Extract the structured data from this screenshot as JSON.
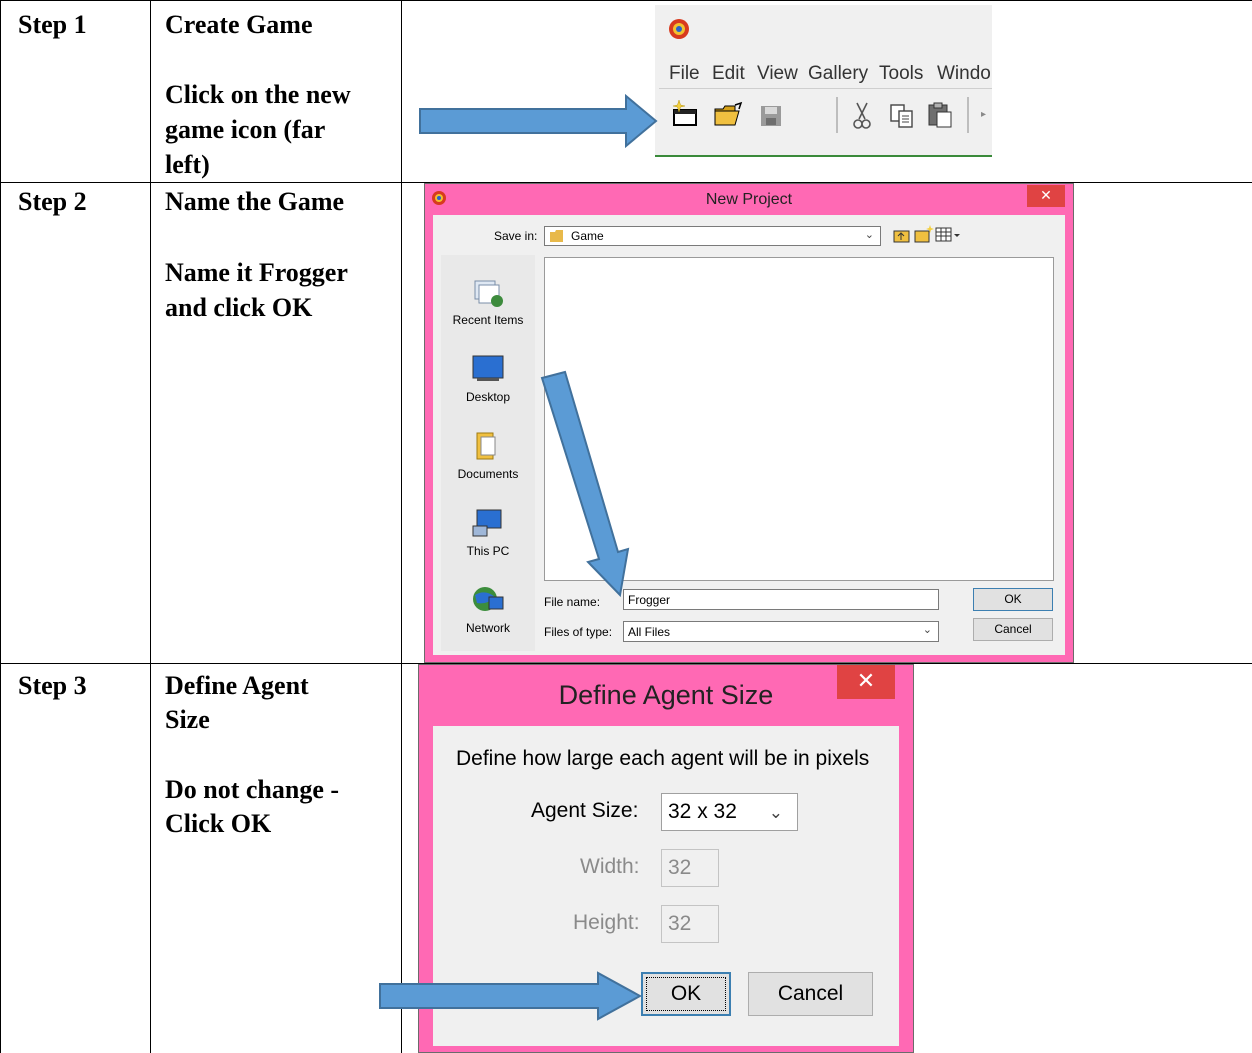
{
  "steps": [
    {
      "number": "Step 1",
      "title": "Create Game",
      "instruction": [
        "Click on the new",
        "game icon (far",
        "left)"
      ]
    },
    {
      "number": "Step 2",
      "title": "Name the Game",
      "instruction": [
        "Name it Frogger",
        "and click OK"
      ]
    },
    {
      "number": "Step 3",
      "title": [
        "Define Agent",
        "Size"
      ],
      "instruction": [
        "Do not change -",
        "Click OK"
      ]
    }
  ],
  "toolbar": {
    "menu": [
      "File",
      "Edit",
      "View",
      "Gallery",
      "Tools",
      "Windo"
    ],
    "icons": [
      "app-logo-icon",
      "new-game-icon",
      "open-folder-icon",
      "save-icon",
      "cut-icon",
      "copy-icon",
      "paste-icon"
    ]
  },
  "new_project_dialog": {
    "title": "New Project",
    "close": "✕",
    "save_in_label": "Save in:",
    "save_in_value": "Game",
    "places": [
      "Recent Items",
      "Desktop",
      "Documents",
      "This PC",
      "Network"
    ],
    "file_name_label": "File name:",
    "file_name_value": "Frogger",
    "files_of_type_label": "Files of type:",
    "files_of_type_value": "All Files",
    "ok": "OK",
    "cancel": "Cancel"
  },
  "agent_size_dialog": {
    "title": "Define Agent Size",
    "close": "✕",
    "description": "Define how large each agent will be in pixels",
    "agent_size_label": "Agent Size:",
    "agent_size_value": "32 x 32",
    "width_label": "Width:",
    "width_value": "32",
    "height_label": "Height:",
    "height_value": "32",
    "ok": "OK",
    "cancel": "Cancel"
  },
  "colors": {
    "dialog_border": "#ff69b4",
    "arrow": "#5b9bd5",
    "close": "#e04343"
  }
}
